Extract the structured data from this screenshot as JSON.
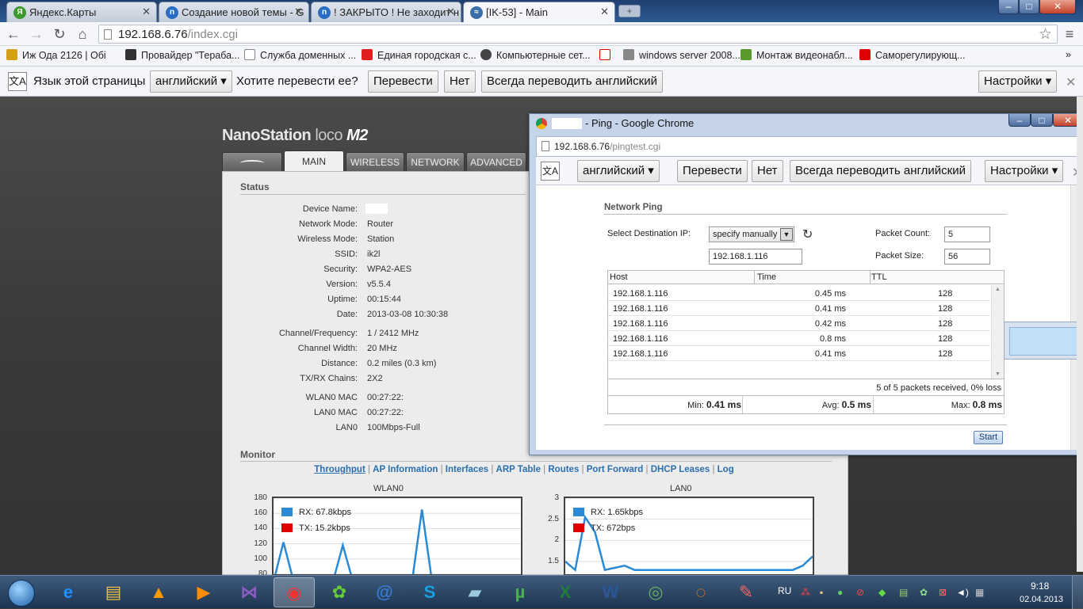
{
  "tabs": [
    {
      "label": "Яндекс.Карты",
      "icon": "yandex-maps-icon"
    },
    {
      "label": "Создание новой темы - G",
      "icon": "nag-icon"
    },
    {
      "label": "! ЗАКРЫТО ! Не заходит н",
      "icon": "nag-icon"
    },
    {
      "label": "[IK-53] - Main",
      "icon": "wifi-icon"
    }
  ],
  "window_controls": {
    "minimize": "–",
    "maximize": "□",
    "close": "✕"
  },
  "toolbar": {
    "back": "←",
    "forward": "→",
    "reload": "↻",
    "home": "⌂",
    "url_host": "192.168.6.76",
    "url_path": "/index.cgi",
    "star": "☆",
    "menu": "≡"
  },
  "bookmarks": [
    {
      "label": "Иж Ода 2126 | Обі",
      "icon": "car-icon"
    },
    {
      "label": "Провайдер \"Тераба...",
      "icon": "mountain-icon"
    },
    {
      "label": "Служба доменных ...",
      "icon": "page-icon"
    },
    {
      "label": "Единая городская с...",
      "icon": "mts-icon"
    },
    {
      "label": "Компьютерные сет...",
      "icon": "network-icon"
    },
    {
      "label": "",
      "icon": "yandex-icon"
    },
    {
      "label": "windows server 2008...",
      "icon": "server-icon"
    },
    {
      "label": "Монтаж видеонабл...",
      "icon": "camera-icon"
    },
    {
      "label": "Саморегулирующ...",
      "icon": "youtube-icon"
    }
  ],
  "bookmarks_more": "»",
  "translate": {
    "label": "Язык этой страницы",
    "language": "английский",
    "question": "Хотите перевести ее?",
    "translate_btn": "Перевести",
    "no_btn": "Нет",
    "always_btn": "Всегда переводить английский",
    "settings_btn": "Настройки",
    "close": "✕"
  },
  "device": {
    "brand_main": "NanoStation",
    "brand_loco": "loco",
    "brand_model": "M2",
    "tabs": [
      "MAIN",
      "WIRELESS",
      "NETWORK",
      "ADVANCED"
    ],
    "status_title": "Status",
    "status_rows": [
      {
        "k": "Device Name:",
        "v": ""
      },
      {
        "k": "Network Mode:",
        "v": "Router"
      },
      {
        "k": "Wireless Mode:",
        "v": "Station"
      },
      {
        "k": "SSID:",
        "v": "ik2l"
      },
      {
        "k": "Security:",
        "v": "WPA2-AES"
      },
      {
        "k": "Version:",
        "v": "v5.5.4"
      },
      {
        "k": "Uptime:",
        "v": "00:15:44"
      },
      {
        "k": "Date:",
        "v": "2013-03-08 10:30:38"
      },
      {
        "k": "Channel/Frequency:",
        "v": "1 / 2412 MHz"
      },
      {
        "k": "Channel Width:",
        "v": "20 MHz"
      },
      {
        "k": "Distance:",
        "v": "0.2 miles (0.3 km)"
      },
      {
        "k": "TX/RX Chains:",
        "v": "2X2"
      },
      {
        "k": "WLAN0 MAC",
        "v": "00:27:22:"
      },
      {
        "k": "LAN0 MAC",
        "v": "00:27:22:"
      },
      {
        "k": "LAN0",
        "v": "100Mbps-Full"
      }
    ],
    "monitor_title": "Monitor",
    "monitor_links": [
      "Throughput",
      "AP Information",
      "Interfaces",
      "ARP Table",
      "Routes",
      "Port Forward",
      "DHCP Leases",
      "Log"
    ]
  },
  "chart_data": [
    {
      "type": "line",
      "title": "WLAN0",
      "yticks": [
        180,
        160,
        140,
        120,
        100,
        80
      ],
      "ylim": [
        80,
        180
      ],
      "legend": [
        {
          "name": "RX: 67.8kbps",
          "color": "#2a8ad4"
        },
        {
          "name": "TX: 15.2kbps",
          "color": "#e00000"
        }
      ],
      "series": [
        {
          "name": "RX: 67.8kbps",
          "values": [
            70,
            122,
            72,
            70,
            70,
            70,
            70,
            118,
            72,
            70,
            70,
            70,
            70,
            70,
            70,
            165,
            72,
            70,
            70,
            70,
            70,
            70,
            76,
            70,
            70,
            78
          ]
        }
      ]
    },
    {
      "type": "line",
      "title": "LAN0",
      "yticks": [
        3,
        2.5,
        2,
        1.5
      ],
      "ylim": [
        1.2,
        3
      ],
      "legend": [
        {
          "name": "RX: 1.65kbps",
          "color": "#2a8ad4"
        },
        {
          "name": "TX: 672bps",
          "color": "#e00000"
        }
      ],
      "series": [
        {
          "name": "RX: 1.65kbps",
          "values": [
            1.5,
            1.3,
            2.55,
            2.2,
            1.3,
            1.35,
            1.4,
            1.3,
            1.3,
            1.3,
            1.3,
            1.3,
            1.3,
            1.3,
            1.3,
            1.3,
            1.3,
            1.3,
            1.3,
            1.3,
            1.3,
            1.3,
            1.3,
            1.3,
            1.4,
            1.62
          ]
        }
      ]
    }
  ],
  "popup": {
    "title": "- Ping - Google Chrome",
    "url_host": "192.168.6.76",
    "url_path": "/pingtest.cgi",
    "heading": "Network Ping",
    "dest_label": "Select Destination IP:",
    "dest_select": "specify manually",
    "dest_value": "192.168.1.116",
    "packet_count_label": "Packet Count:",
    "packet_count": "5",
    "packet_size_label": "Packet Size:",
    "packet_size": "56",
    "columns": [
      "Host",
      "Time",
      "TTL"
    ],
    "rows": [
      {
        "host": "192.168.1.116",
        "time": "0.45 ms",
        "ttl": "128"
      },
      {
        "host": "192.168.1.116",
        "time": "0.41 ms",
        "ttl": "128"
      },
      {
        "host": "192.168.1.116",
        "time": "0.42 ms",
        "ttl": "128"
      },
      {
        "host": "192.168.1.116",
        "time": "0.8 ms",
        "ttl": "128"
      },
      {
        "host": "192.168.1.116",
        "time": "0.41 ms",
        "ttl": "128"
      }
    ],
    "summary": "5 of 5 packets received, 0% loss",
    "min_label": "Min:",
    "min_value": "0.41 ms",
    "avg_label": "Avg:",
    "avg_value": "0.5 ms",
    "max_label": "Max:",
    "max_value": "0.8 ms",
    "start_btn": "Start"
  },
  "taskbar": {
    "apps": [
      "start-orb",
      "ie-icon",
      "explorer-icon",
      "aimp-icon",
      "media-player-icon",
      "visual-studio-icon",
      "chrome-icon",
      "icq-icon",
      "thunderbird-icon",
      "skype-icon",
      "notepad-icon",
      "utorrent-icon",
      "excel-icon",
      "word-icon",
      "winbox-icon",
      "avast-icon",
      "paint-icon"
    ],
    "lang": "RU",
    "time": "9:18",
    "date": "02.04.2013"
  }
}
